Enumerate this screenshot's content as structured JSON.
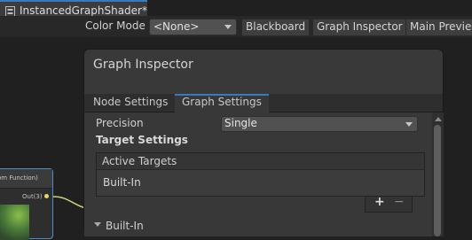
{
  "window": {
    "tab_title": "InstancedGraphShader*"
  },
  "toolbar": {
    "color_mode_label": "Color Mode",
    "color_mode_value": "<None>",
    "blackboard_button": "Blackboard",
    "graph_inspector_button": "Graph Inspector",
    "main_preview_button": "Main Previev"
  },
  "node": {
    "title": "om Function)",
    "out_port_label": "Out(3)"
  },
  "inspector": {
    "title": "Graph Inspector",
    "tabs": [
      {
        "label": "Node Settings",
        "active": false
      },
      {
        "label": "Graph Settings",
        "active": true
      }
    ],
    "precision_label": "Precision",
    "precision_value": "Single",
    "target_settings_label": "Target Settings",
    "active_targets_header": "Active Targets",
    "active_targets": [
      "Built-In"
    ],
    "add_symbol": "+",
    "remove_symbol": "−",
    "section_label": "Built-In"
  },
  "colors": {
    "accent": "#3a79bb",
    "node_border": "#4a8fc7",
    "port": "#e2d86a"
  }
}
